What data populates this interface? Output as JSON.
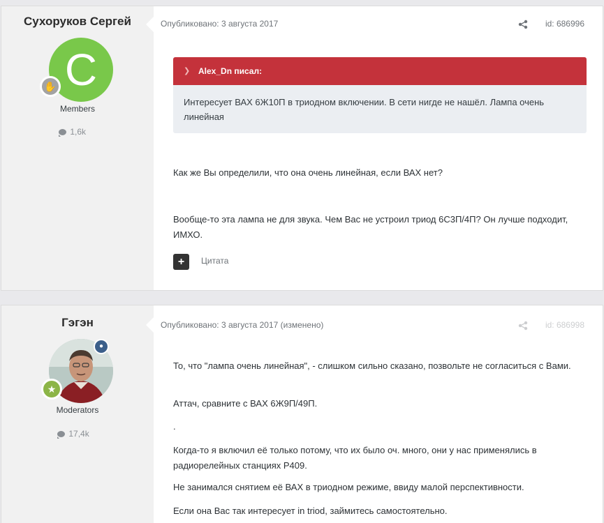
{
  "posts": [
    {
      "author": "Сухоруков Сергей",
      "avatar_letter": "С",
      "group": "Members",
      "post_count": "1,6k",
      "published": "Опубликовано: 3 августа 2017",
      "post_id": "id: 686996",
      "quote": {
        "header": "Alex_Dn писал:",
        "text": "Интересует ВАХ 6Ж10П в триодном включении. В сети нигде не нашёл. Лампа очень линейная"
      },
      "paragraphs": [
        "Как же Вы определили, что она очень линейная, если ВАХ нет?",
        "Вообще-то эта лампа не для звука. Чем Вас не устроил триод 6С3П/4П? Он лучше подходит, ИМХО."
      ],
      "quote_button_label": "Цитата"
    },
    {
      "author": "Гэгэн",
      "group": "Moderators",
      "post_count": "17,4k",
      "published": "Опубликовано: 3 августа 2017 (изменено)",
      "post_id": "id: 686998",
      "paragraphs": [
        "То, что \"лампа очень линейная\", - слишком сильно сказано, позвольте не согласиться с Вами.",
        "Аттач, сравните с ВАХ 6Ж9П/49П.",
        ".",
        "Когда-то я включил её только потому, что их было оч. много, они у нас применялись в радиорелейных станциях Р409.",
        "Не занимался снятием её ВАХ в триодном режиме, ввиду малой перспективности.",
        "Если она Вас так интересует in triod, займитесь самостоятельно."
      ]
    }
  ]
}
